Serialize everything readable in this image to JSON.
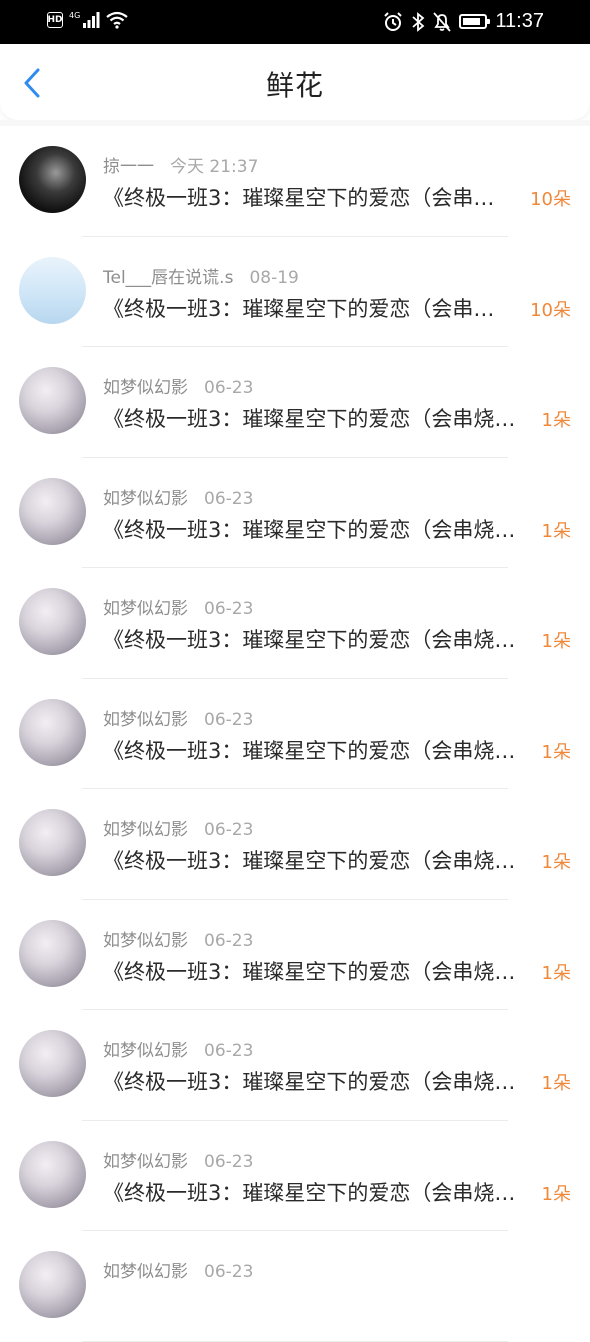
{
  "status_bar": {
    "hd_label": "HD",
    "network_label": "4G",
    "time": "11:37"
  },
  "nav": {
    "title": "鲜花"
  },
  "items": [
    {
      "name": "掠一一",
      "date": "今天 21:37",
      "title": "《终极一班3：璀璨星空下的爱恋（会串…",
      "count": "10朵",
      "avatar": "dark"
    },
    {
      "name": "Tel___唇在说谎.s",
      "date": "08-19",
      "title": "《终极一班3：璀璨星空下的爱恋（会串…",
      "count": "10朵",
      "avatar": "hello"
    },
    {
      "name": "如梦似幻影",
      "date": "06-23",
      "title": "《终极一班3：璀璨星空下的爱恋（会串烧…",
      "count": "1朵",
      "avatar": "portrait"
    },
    {
      "name": "如梦似幻影",
      "date": "06-23",
      "title": "《终极一班3：璀璨星空下的爱恋（会串烧…",
      "count": "1朵",
      "avatar": "portrait"
    },
    {
      "name": "如梦似幻影",
      "date": "06-23",
      "title": "《终极一班3：璀璨星空下的爱恋（会串烧…",
      "count": "1朵",
      "avatar": "portrait"
    },
    {
      "name": "如梦似幻影",
      "date": "06-23",
      "title": "《终极一班3：璀璨星空下的爱恋（会串烧…",
      "count": "1朵",
      "avatar": "portrait"
    },
    {
      "name": "如梦似幻影",
      "date": "06-23",
      "title": "《终极一班3：璀璨星空下的爱恋（会串烧…",
      "count": "1朵",
      "avatar": "portrait"
    },
    {
      "name": "如梦似幻影",
      "date": "06-23",
      "title": "《终极一班3：璀璨星空下的爱恋（会串烧…",
      "count": "1朵",
      "avatar": "portrait"
    },
    {
      "name": "如梦似幻影",
      "date": "06-23",
      "title": "《终极一班3：璀璨星空下的爱恋（会串烧…",
      "count": "1朵",
      "avatar": "portrait"
    },
    {
      "name": "如梦似幻影",
      "date": "06-23",
      "title": "《终极一班3：璀璨星空下的爱恋（会串烧…",
      "count": "1朵",
      "avatar": "portrait"
    },
    {
      "name": "如梦似幻影",
      "date": "06-23",
      "title": "",
      "count": "",
      "avatar": "portrait"
    }
  ],
  "colors": {
    "accent": "#f0883a",
    "back_arrow": "#2e8cf0"
  },
  "icons": [
    "hd-icon",
    "signal-icon",
    "wifi-icon",
    "alarm-icon",
    "bluetooth-icon",
    "mute-bell-icon",
    "battery-icon",
    "back-arrow-icon"
  ]
}
